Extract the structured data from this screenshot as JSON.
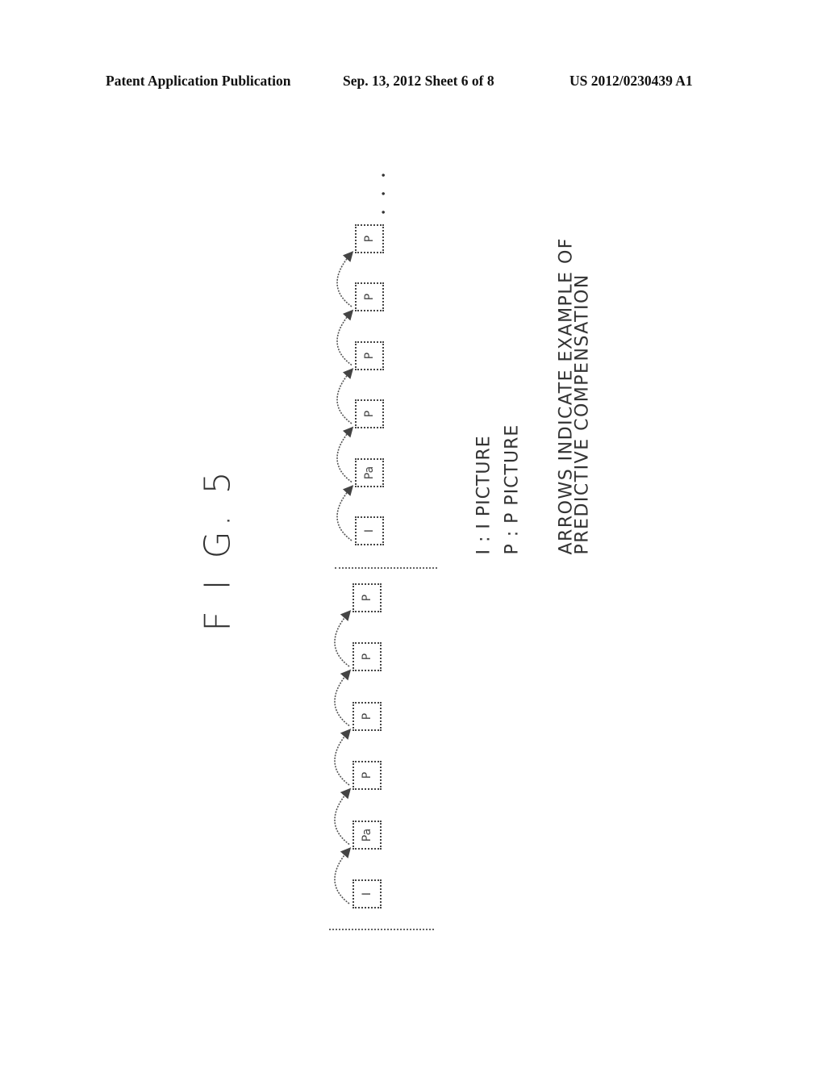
{
  "header": {
    "left": "Patent Application Publication",
    "middle": "Sep. 13, 2012   Sheet 6 of 8",
    "right": "US 2012/0230439 A1"
  },
  "figure": {
    "title": "F I G. 5",
    "groups": [
      {
        "frames": [
          "I",
          "Pa",
          "P",
          "P",
          "P",
          "P"
        ]
      },
      {
        "frames": [
          "I",
          "Pa",
          "P",
          "P",
          "P",
          "P"
        ],
        "continuation": "• • •"
      }
    ],
    "legend": {
      "i_line": "I : I PICTURE",
      "p_line": "P : P PICTURE",
      "arrows_line1": "ARROWS INDICATE EXAMPLE OF",
      "arrows_line2": "PREDICTIVE COMPENSATION"
    }
  }
}
